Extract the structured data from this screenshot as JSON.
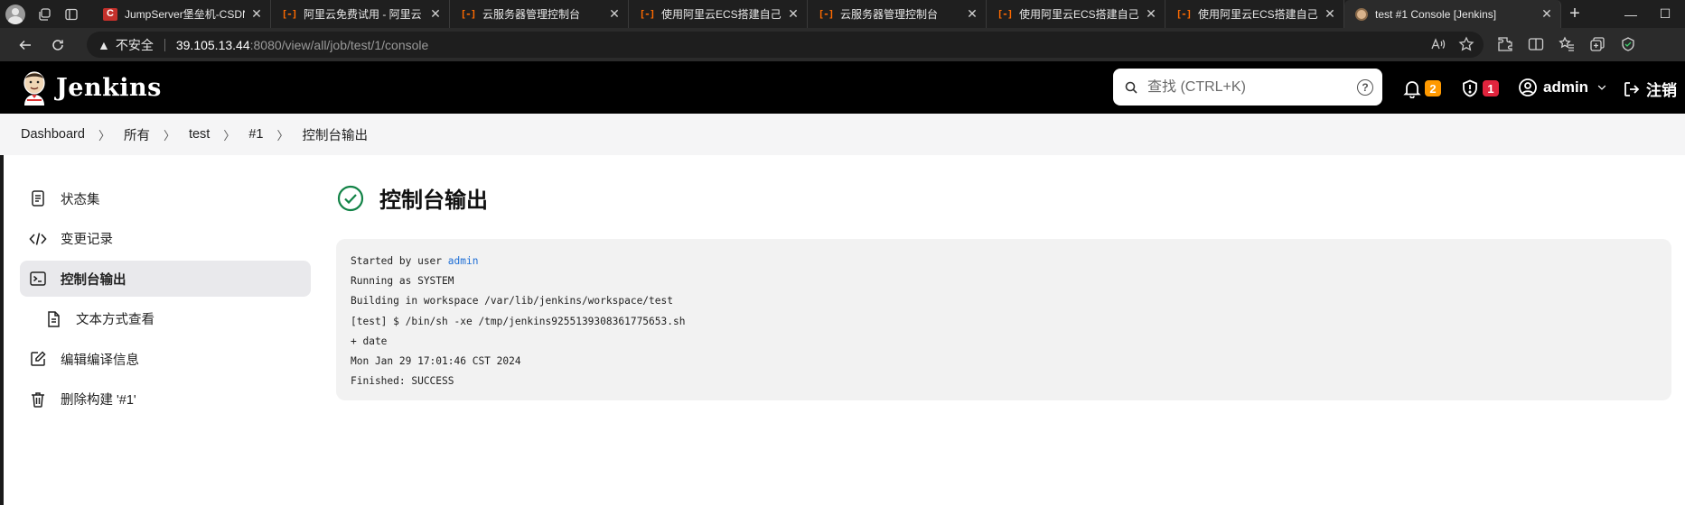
{
  "browser": {
    "tabs": [
      {
        "title": "JumpServer堡垒机-CSDN",
        "favicon": "csdn"
      },
      {
        "title": "阿里云免费试用 - 阿里云",
        "favicon": "aliyun"
      },
      {
        "title": "云服务器管理控制台",
        "favicon": "aliyun"
      },
      {
        "title": "使用阿里云ECS搭建自己",
        "favicon": "aliyun"
      },
      {
        "title": "云服务器管理控制台",
        "favicon": "aliyun"
      },
      {
        "title": "使用阿里云ECS搭建自己",
        "favicon": "aliyun"
      },
      {
        "title": "使用阿里云ECS搭建自己",
        "favicon": "aliyun"
      },
      {
        "title": "test #1 Console [Jenkins]",
        "favicon": "jenkins",
        "active": true
      }
    ],
    "tab_close_glyph": "✕",
    "new_tab_glyph": "+",
    "window_controls": {
      "minimize": "—",
      "maximize": "☐",
      "close": "✕"
    },
    "address": {
      "security_label": "不安全",
      "url_host": "39.105.13.44",
      "url_rest": ":8080/view/all/job/test/1/console"
    }
  },
  "jenkins": {
    "brand": "Jenkins",
    "search_placeholder": "查找 (CTRL+K)",
    "help_glyph": "?",
    "notifications_count": "2",
    "security_count": "1",
    "user": "admin",
    "logout_label": "注销",
    "colors": {
      "header_bg": "#000000",
      "success": "#138347",
      "notif_badge": "#ff9900",
      "security_badge": "#e0243d",
      "link": "#1f6fd6"
    }
  },
  "breadcrumb": [
    "Dashboard",
    "所有",
    "test",
    "#1",
    "控制台输出"
  ],
  "sidepanel": [
    {
      "label": "状态集",
      "icon": "status-icon"
    },
    {
      "label": "变更记录",
      "icon": "code-icon"
    },
    {
      "label": "控制台输出",
      "icon": "terminal-icon",
      "active": true
    },
    {
      "label": "文本方式查看",
      "icon": "document-icon",
      "sub": true
    },
    {
      "label": "编辑编译信息",
      "icon": "edit-icon"
    },
    {
      "label": "删除构建 '#1'",
      "icon": "trash-icon"
    }
  ],
  "main": {
    "title": "控制台输出",
    "console": {
      "started_by_prefix": "Started by user ",
      "started_by_user": "admin",
      "lines": [
        "Running as SYSTEM",
        "Building in workspace /var/lib/jenkins/workspace/test",
        "[test] $ /bin/sh -xe /tmp/jenkins9255139308361775653.sh",
        "+ date",
        "Mon Jan 29 17:01:46 CST 2024",
        "Finished: SUCCESS"
      ]
    }
  }
}
